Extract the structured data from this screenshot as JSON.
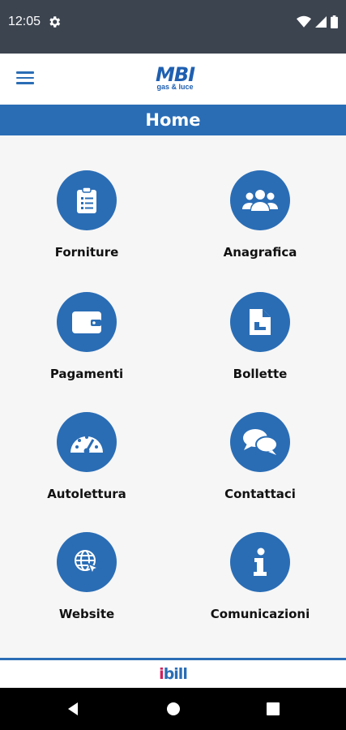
{
  "status_bar": {
    "time": "12:05"
  },
  "app_bar": {
    "logo_main": "MBI",
    "logo_sub": "gas & luce"
  },
  "page": {
    "title": "Home"
  },
  "menu": {
    "items": [
      {
        "label": "Forniture",
        "icon": "clipboard-icon"
      },
      {
        "label": "Anagrafica",
        "icon": "users-icon"
      },
      {
        "label": "Pagamenti",
        "icon": "wallet-icon"
      },
      {
        "label": "Bollette",
        "icon": "document-icon"
      },
      {
        "label": "Autolettura",
        "icon": "gauge-icon"
      },
      {
        "label": "Contattaci",
        "icon": "chat-icon"
      },
      {
        "label": "Website",
        "icon": "globe-icon"
      },
      {
        "label": "Comunicazioni",
        "icon": "info-icon"
      }
    ]
  },
  "footer": {
    "brand_i": "i",
    "brand_rest": "bill"
  },
  "colors": {
    "primary": "#2a6db5",
    "accent": "#d0215e",
    "status_bar": "#3c4450"
  }
}
